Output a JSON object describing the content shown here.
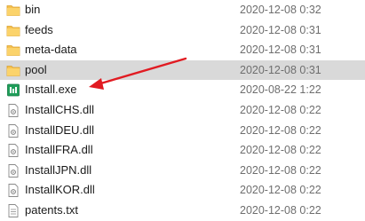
{
  "accent_color": "#e11b22",
  "files": [
    {
      "name": "bin",
      "date": "2020-12-08 0:32",
      "icon": "folder-icon",
      "selected": false
    },
    {
      "name": "feeds",
      "date": "2020-12-08 0:31",
      "icon": "folder-icon",
      "selected": false
    },
    {
      "name": "meta-data",
      "date": "2020-12-08 0:31",
      "icon": "folder-icon",
      "selected": false
    },
    {
      "name": "pool",
      "date": "2020-12-08 0:31",
      "icon": "folder-icon",
      "selected": true
    },
    {
      "name": "Install.exe",
      "date": "2020-08-22 1:22",
      "icon": "installer-app-icon",
      "selected": false
    },
    {
      "name": "InstallCHS.dll",
      "date": "2020-12-08 0:22",
      "icon": "dll-file-icon",
      "selected": false
    },
    {
      "name": "InstallDEU.dll",
      "date": "2020-12-08 0:22",
      "icon": "dll-file-icon",
      "selected": false
    },
    {
      "name": "InstallFRA.dll",
      "date": "2020-12-08 0:22",
      "icon": "dll-file-icon",
      "selected": false
    },
    {
      "name": "InstallJPN.dll",
      "date": "2020-12-08 0:22",
      "icon": "dll-file-icon",
      "selected": false
    },
    {
      "name": "InstallKOR.dll",
      "date": "2020-12-08 0:22",
      "icon": "dll-file-icon",
      "selected": false
    },
    {
      "name": "patents.txt",
      "date": "2020-12-08 0:22",
      "icon": "text-file-icon",
      "selected": false
    }
  ]
}
